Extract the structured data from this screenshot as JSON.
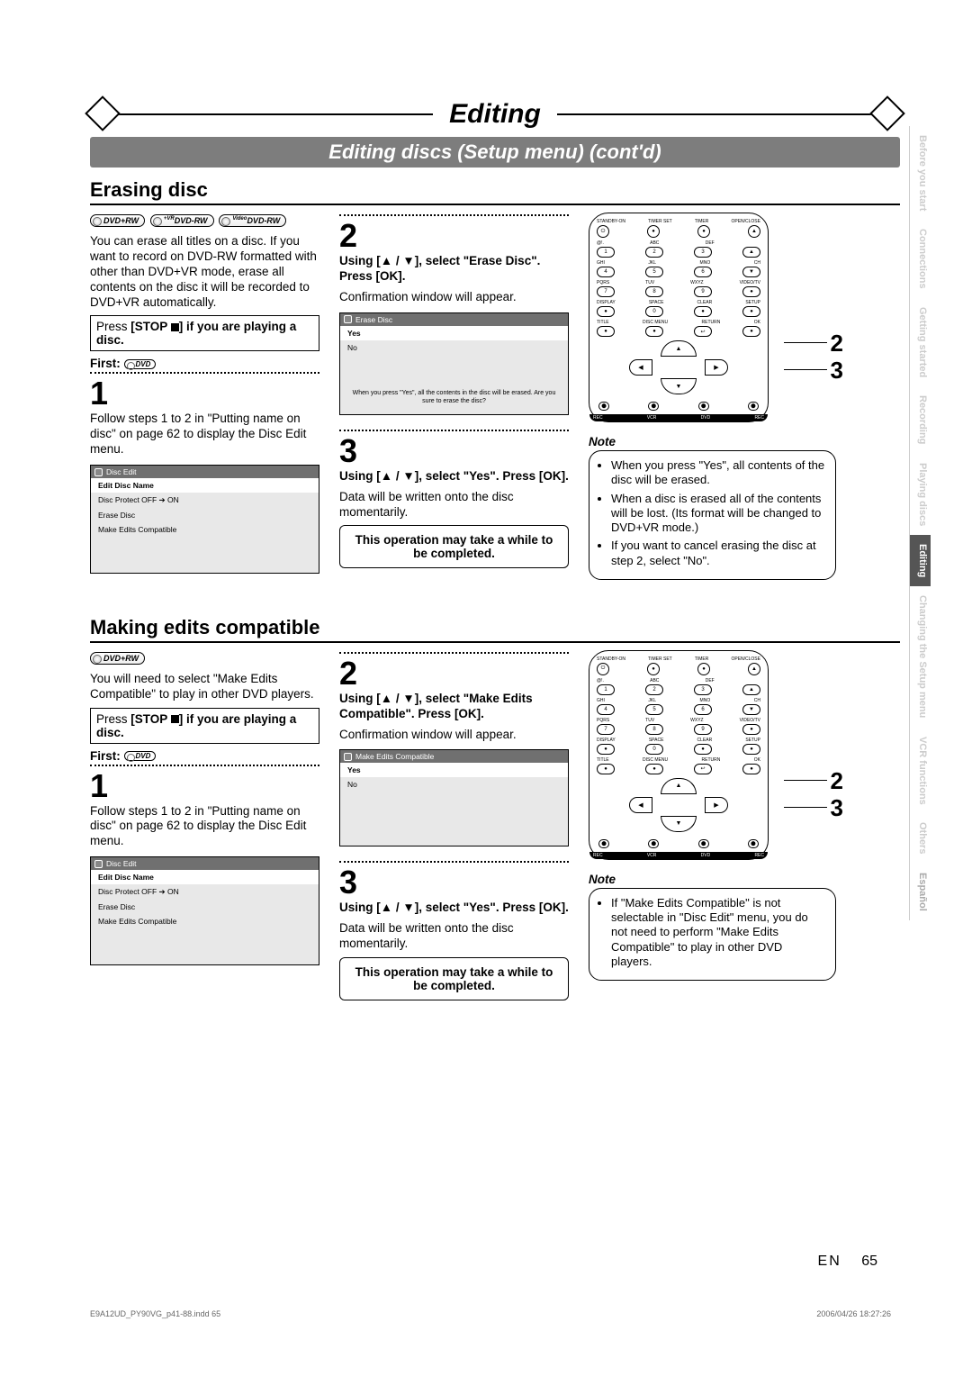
{
  "header": {
    "title": "Editing",
    "subtitle": "Editing discs (Setup menu) (cont'd)"
  },
  "section1": {
    "heading": "Erasing disc",
    "badges": [
      "DVD+RW",
      "DVD-RW",
      "DVD-RW"
    ],
    "badge_sup": [
      "",
      "+VR",
      "Video"
    ],
    "intro": "You can erase all titles on a disc. If you want to record on DVD-RW formatted with other than DVD+VR mode, erase all contents on the disc it will be recorded to DVD+VR automatically.",
    "stop_note_pre": "Press ",
    "stop_note_bold": "[STOP ",
    "stop_note_post": "] if you are playing a disc.",
    "first_label": "First:",
    "first_badge": "DVD",
    "step1_num": "1",
    "step1_text": "Follow steps 1 to 2 in \"Putting name on disc\" on page 62 to display the Disc Edit menu.",
    "osd1_title": "Disc Edit",
    "osd1_items": [
      "Edit Disc Name",
      "Disc Protect OFF  ➔  ON",
      "Erase Disc",
      "Make Edits Compatible"
    ],
    "step2_num": "2",
    "step2_instr_a": "Using [▲ / ▼], select \"Erase Disc\". Press [OK].",
    "step2_text": "Confirmation window will appear.",
    "osd2_title": "Erase Disc",
    "osd2_items": [
      "Yes",
      "No"
    ],
    "osd2_msg": "When you press \"Yes\", all the contents in the disc will be erased. Are you sure to erase the disc?",
    "step3_num": "3",
    "step3_instr": "Using [▲ / ▼], select \"Yes\". Press [OK].",
    "step3_text": "Data will be written onto the disc momentarily.",
    "warn": "This operation may take a while to be completed.",
    "note_head": "Note",
    "notes": [
      "When you press \"Yes\", all contents of the disc will be erased.",
      "When a disc is erased all of the contents will be lost. (Its format will be changed to DVD+VR mode.)",
      "If you want to cancel erasing the disc at step 2, select \"No\"."
    ],
    "callout2": "2",
    "callout3": "3"
  },
  "section2": {
    "heading": "Making edits compatible",
    "badges": [
      "DVD+RW"
    ],
    "intro": "You will need to select \"Make Edits Compatible\" to play in other DVD players.",
    "stop_note_pre": "Press ",
    "stop_note_bold": "[STOP ",
    "stop_note_post": "] if you are playing a disc.",
    "first_label": "First:",
    "first_badge": "DVD",
    "step1_num": "1",
    "step1_text": "Follow steps 1 to 2 in \"Putting name on disc\" on page 62 to display the Disc Edit menu.",
    "osd1_title": "Disc Edit",
    "osd1_items": [
      "Edit Disc Name",
      "Disc Protect OFF  ➔  ON",
      "Erase Disc",
      "Make Edits Compatible"
    ],
    "step2_num": "2",
    "step2_instr_a": "Using [▲ / ▼], select \"Make Edits Compatible\". Press [OK].",
    "step2_text": "Confirmation window will appear.",
    "osd2_title": "Make Edits Compatible",
    "osd2_items": [
      "Yes",
      "No"
    ],
    "step3_num": "3",
    "step3_instr": "Using [▲ / ▼], select \"Yes\". Press [OK].",
    "step3_text": "Data will be written onto the disc momentarily.",
    "warn": "This operation may take a while to be completed.",
    "note_head": "Note",
    "notes": [
      "If \"Make Edits Compatible\" is not selectable in \"Disc Edit\" menu, you do not need to perform \"Make Edits Compatible\" to play in other DVD players."
    ],
    "callout2": "2",
    "callout3": "3"
  },
  "remote": {
    "row1_lbl": [
      "STANDBY-ON",
      "TIMER SET",
      "TIMER",
      "OPEN/CLOSE"
    ],
    "row2_lbl": [
      "@!.",
      "ABC",
      "DEF",
      ""
    ],
    "row2_btn": [
      "1",
      "2",
      "3",
      "▲"
    ],
    "row3_lbl": [
      "GHI",
      "JKL",
      "MNO",
      "CH"
    ],
    "row3_btn": [
      "4",
      "5",
      "6",
      "▼"
    ],
    "row4_lbl": [
      "PQRS",
      "TUV",
      "WXYZ",
      "VIDEO/TV"
    ],
    "row4_btn": [
      "7",
      "8",
      "9",
      "●"
    ],
    "row5_lbl": [
      "DISPLAY",
      "SPACE",
      "CLEAR",
      "SETUP"
    ],
    "row5_btn": [
      "●",
      "0",
      "●",
      "●"
    ],
    "row6_lbl": [
      "TITLE",
      "DISC MENU",
      "RETURN",
      "OK"
    ],
    "row6_btn": [
      "●",
      "●",
      "↩",
      "●"
    ],
    "dpad": [
      "▲",
      "▼",
      "◀",
      "▶"
    ],
    "bottom_lbl": [
      "REC",
      "VCR",
      "DVD",
      "REC"
    ],
    "bottom_ico": [
      "⬤",
      "⬤",
      "⬤",
      "⬤"
    ]
  },
  "sidetabs": [
    {
      "label": "Before you start",
      "active": false
    },
    {
      "label": "Connections",
      "active": false
    },
    {
      "label": "Getting started",
      "active": false
    },
    {
      "label": "Recording",
      "active": false
    },
    {
      "label": "Playing discs",
      "active": false
    },
    {
      "label": "Editing",
      "active": true
    },
    {
      "label": "Changing the Setup menu",
      "active": false
    },
    {
      "label": "VCR functions",
      "active": false
    },
    {
      "label": "Others",
      "active": false
    },
    {
      "label": "Español",
      "active": false
    }
  ],
  "footer": {
    "lang": "EN",
    "page": "65",
    "foot_l": "E9A12UD_PY90VG_p41-88.indd   65",
    "foot_r": "2006/04/26   18:27:26"
  }
}
